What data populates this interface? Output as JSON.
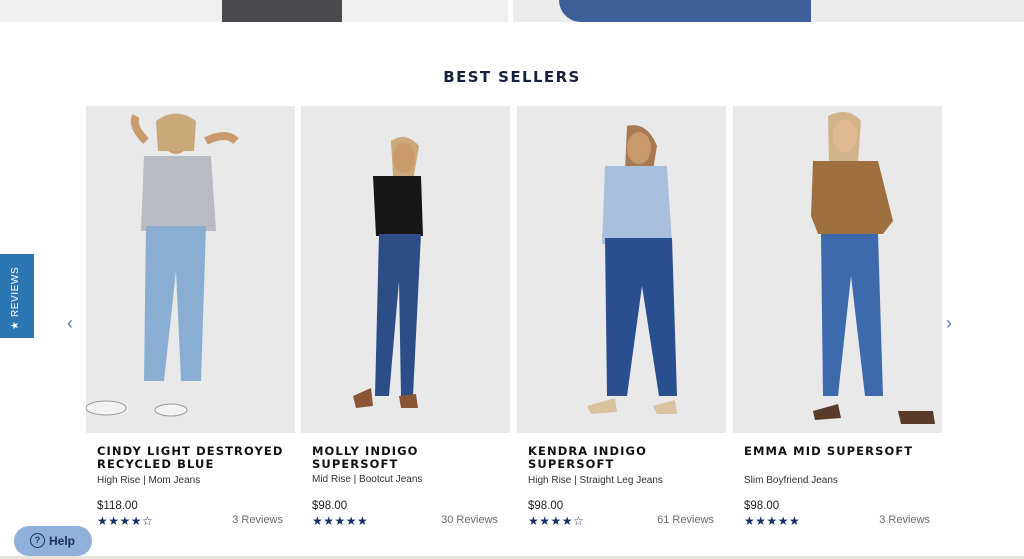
{
  "section": {
    "title": "BEST SELLERS"
  },
  "products": [
    {
      "name": "CINDY LIGHT DESTROYED RECYCLED BLUE",
      "description": "High Rise | Mom Jeans",
      "price": "$118.00",
      "rating_stars": "★★★★☆",
      "rating": 4.5,
      "reviews": "3 Reviews"
    },
    {
      "name": "MOLLY INDIGO SUPERSOFT",
      "description": "Mid Rise | Bootcut Jeans",
      "price": "$98.00",
      "rating_stars": "★★★★★",
      "rating": 5,
      "reviews": "30 Reviews"
    },
    {
      "name": "KENDRA INDIGO SUPERSOFT",
      "description": "High Rise | Straight Leg Jeans",
      "price": "$98.00",
      "rating_stars": "★★★★☆",
      "rating": 4.5,
      "reviews": "61 Reviews"
    },
    {
      "name": "EMMA MID SUPERSOFT",
      "description": "Slim Boyfriend Jeans",
      "price": "$98.00",
      "rating_stars": "★★★★★",
      "rating": 5,
      "reviews": "3 Reviews"
    }
  ],
  "nav": {
    "prev_icon": "‹",
    "next_icon": "›"
  },
  "reviews_tab": {
    "label": "★ REVIEWS"
  },
  "help": {
    "icon": "?",
    "label": "Help"
  },
  "colors": {
    "title": "#17213d",
    "stars": "#1a2f63",
    "reviews_tab": "#2c76b4",
    "help": "#8fb1d9"
  }
}
